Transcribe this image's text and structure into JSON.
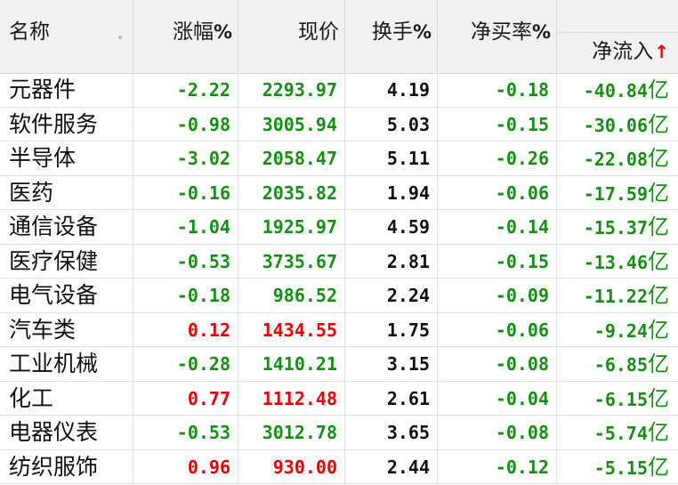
{
  "header": {
    "name": "名称",
    "change": "涨幅",
    "change_pct": "%",
    "price": "现价",
    "turnover": "换手",
    "turnover_pct": "%",
    "net_buy": "净买率",
    "net_buy_pct": "%",
    "net_flow": "净流入",
    "sort_arrow": "↑"
  },
  "colors": {
    "down": "#159015",
    "up": "#e80000",
    "neutral": "#111111"
  },
  "unit": "亿",
  "rows": [
    {
      "name": "元器件",
      "change": "-2.22",
      "price": "2293.97",
      "turnover": "4.19",
      "net_buy": "-0.18",
      "net_flow": "-40.84",
      "dir": "down"
    },
    {
      "name": "软件服务",
      "change": "-0.98",
      "price": "3005.94",
      "turnover": "5.03",
      "net_buy": "-0.15",
      "net_flow": "-30.06",
      "dir": "down"
    },
    {
      "name": "半导体",
      "change": "-3.02",
      "price": "2058.47",
      "turnover": "5.11",
      "net_buy": "-0.26",
      "net_flow": "-22.08",
      "dir": "down"
    },
    {
      "name": "医药",
      "change": "-0.16",
      "price": "2035.82",
      "turnover": "1.94",
      "net_buy": "-0.06",
      "net_flow": "-17.59",
      "dir": "down"
    },
    {
      "name": "通信设备",
      "change": "-1.04",
      "price": "1925.97",
      "turnover": "4.59",
      "net_buy": "-0.14",
      "net_flow": "-15.37",
      "dir": "down"
    },
    {
      "name": "医疗保健",
      "change": "-0.53",
      "price": "3735.67",
      "turnover": "2.81",
      "net_buy": "-0.15",
      "net_flow": "-13.46",
      "dir": "down"
    },
    {
      "name": "电气设备",
      "change": "-0.18",
      "price": "986.52",
      "turnover": "2.24",
      "net_buy": "-0.09",
      "net_flow": "-11.22",
      "dir": "down"
    },
    {
      "name": "汽车类",
      "change": "0.12",
      "price": "1434.55",
      "turnover": "1.75",
      "net_buy": "-0.06",
      "net_flow": "-9.24",
      "dir": "up"
    },
    {
      "name": "工业机械",
      "change": "-0.28",
      "price": "1410.21",
      "turnover": "3.15",
      "net_buy": "-0.08",
      "net_flow": "-6.85",
      "dir": "down"
    },
    {
      "name": "化工",
      "change": "0.77",
      "price": "1112.48",
      "turnover": "2.61",
      "net_buy": "-0.04",
      "net_flow": "-6.15",
      "dir": "up"
    },
    {
      "name": "电器仪表",
      "change": "-0.53",
      "price": "3012.78",
      "turnover": "3.65",
      "net_buy": "-0.08",
      "net_flow": "-5.74",
      "dir": "down"
    },
    {
      "name": "纺织服饰",
      "change": "0.96",
      "price": "930.00",
      "turnover": "2.44",
      "net_buy": "-0.12",
      "net_flow": "-5.15",
      "dir": "up"
    }
  ]
}
